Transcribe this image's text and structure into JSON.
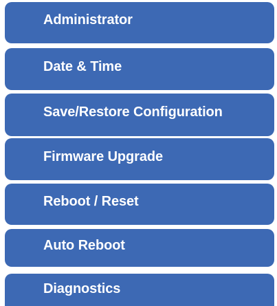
{
  "menu": {
    "items": [
      {
        "label": "Administrator"
      },
      {
        "label": "Date & Time"
      },
      {
        "label": "Save/Restore Configuration"
      },
      {
        "label": "Firmware Upgrade"
      },
      {
        "label": "Reboot / Reset"
      },
      {
        "label": "Auto Reboot"
      },
      {
        "label": "Diagnostics"
      }
    ],
    "colors": {
      "item_background": "#3d69b4",
      "item_text": "#ffffff",
      "page_background": "#ffffff"
    }
  }
}
